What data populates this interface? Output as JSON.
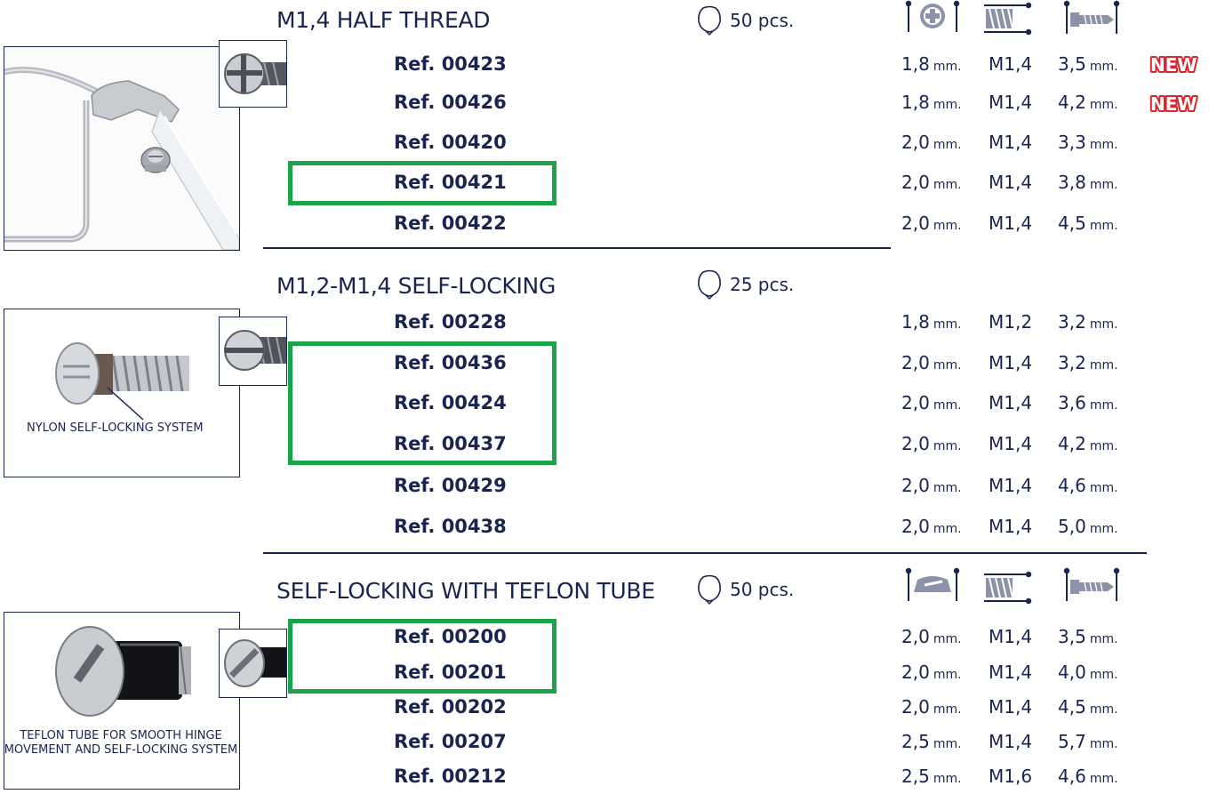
{
  "sections": [
    {
      "title": "M1,4 HALF THREAD",
      "pcs": "50 pcs.",
      "rows": [
        {
          "ref": "Ref. 00423",
          "d": "1,8",
          "thread": "M1,4",
          "len": "3,5",
          "new": true
        },
        {
          "ref": "Ref. 00426",
          "d": "1,8",
          "thread": "M1,4",
          "len": "4,2",
          "new": true
        },
        {
          "ref": "Ref. 00420",
          "d": "2,0",
          "thread": "M1,4",
          "len": "3,3",
          "new": false
        },
        {
          "ref": "Ref. 00421",
          "d": "2,0",
          "thread": "M1,4",
          "len": "3,8",
          "new": false
        },
        {
          "ref": "Ref. 00422",
          "d": "2,0",
          "thread": "M1,4",
          "len": "4,5",
          "new": false
        }
      ]
    },
    {
      "title": "M1,2-M1,4 SELF-LOCKING",
      "pcs": "25 pcs.",
      "caption": "NYLON SELF-LOCKING SYSTEM",
      "rows": [
        {
          "ref": "Ref. 00228",
          "d": "1,8",
          "thread": "M1,2",
          "len": "3,2"
        },
        {
          "ref": "Ref. 00436",
          "d": "2,0",
          "thread": "M1,4",
          "len": "3,2"
        },
        {
          "ref": "Ref. 00424",
          "d": "2,0",
          "thread": "M1,4",
          "len": "3,6"
        },
        {
          "ref": "Ref. 00437",
          "d": "2,0",
          "thread": "M1,4",
          "len": "4,2"
        },
        {
          "ref": "Ref. 00429",
          "d": "2,0",
          "thread": "M1,4",
          "len": "4,6"
        },
        {
          "ref": "Ref. 00438",
          "d": "2,0",
          "thread": "M1,4",
          "len": "5,0"
        }
      ]
    },
    {
      "title": "SELF-LOCKING WITH TEFLON TUBE",
      "pcs": "50 pcs.",
      "caption": "TEFLON TUBE FOR SMOOTH HINGE MOVEMENT AND SELF-LOCKING SYSTEM",
      "rows": [
        {
          "ref": "Ref. 00200",
          "d": "2,0",
          "thread": "M1,4",
          "len": "3,5"
        },
        {
          "ref": "Ref. 00201",
          "d": "2,0",
          "thread": "M1,4",
          "len": "4,0"
        },
        {
          "ref": "Ref. 00202",
          "d": "2,0",
          "thread": "M1,4",
          "len": "4,5"
        },
        {
          "ref": "Ref. 00207",
          "d": "2,5",
          "thread": "M1,4",
          "len": "5,7"
        },
        {
          "ref": "Ref. 00212",
          "d": "2,5",
          "thread": "M1,6",
          "len": "4,6"
        }
      ]
    }
  ],
  "unit": "mm.",
  "new_badge": "NEW",
  "icons": [
    "head-diameter-icon",
    "thread-icon",
    "length-icon",
    "package-icon"
  ],
  "colors": {
    "navy": "#1a2450",
    "green_highlight": "#1ca34a",
    "new_red": "#d9262a",
    "icon_grey": "#8a93a8"
  }
}
